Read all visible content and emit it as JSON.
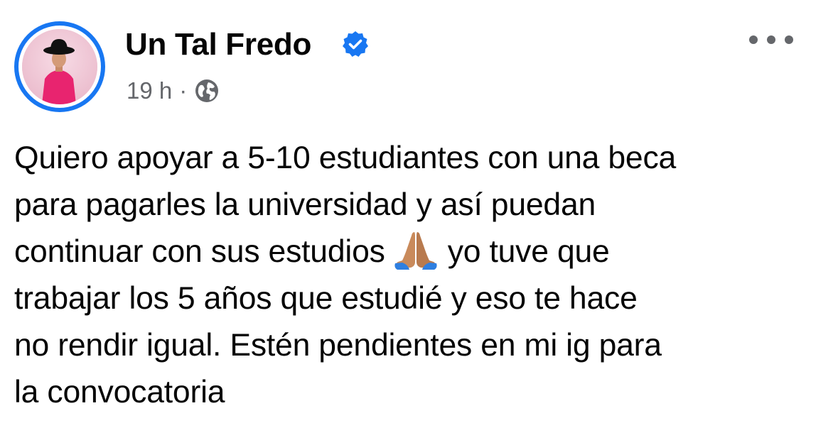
{
  "post": {
    "author": {
      "name": "Un Tal Fredo",
      "verified": true,
      "avatar_icon": "profile-photo"
    },
    "meta": {
      "time": "19 h",
      "separator": "·",
      "privacy_icon": "globe-icon"
    },
    "more_options_icon": "more-horizontal-icon",
    "text_lines": {
      "line1": "Quiero apoyar a 5-10 estudiantes con una beca",
      "line2": "para pagarles la universidad y así puedan",
      "line3_before": "continuar con sus estudios",
      "line3_emoji": "folded-hands-emoji",
      "line3_after": "yo tuve que",
      "line4": "trabajar los 5 años que estudié y eso te hace",
      "line5": "no rendir igual. Estén pendientes en mi ig para",
      "line6": "la convocatoria"
    }
  },
  "colors": {
    "accent": "#1877f2",
    "text": "#050505",
    "secondary_text": "#65676b"
  }
}
